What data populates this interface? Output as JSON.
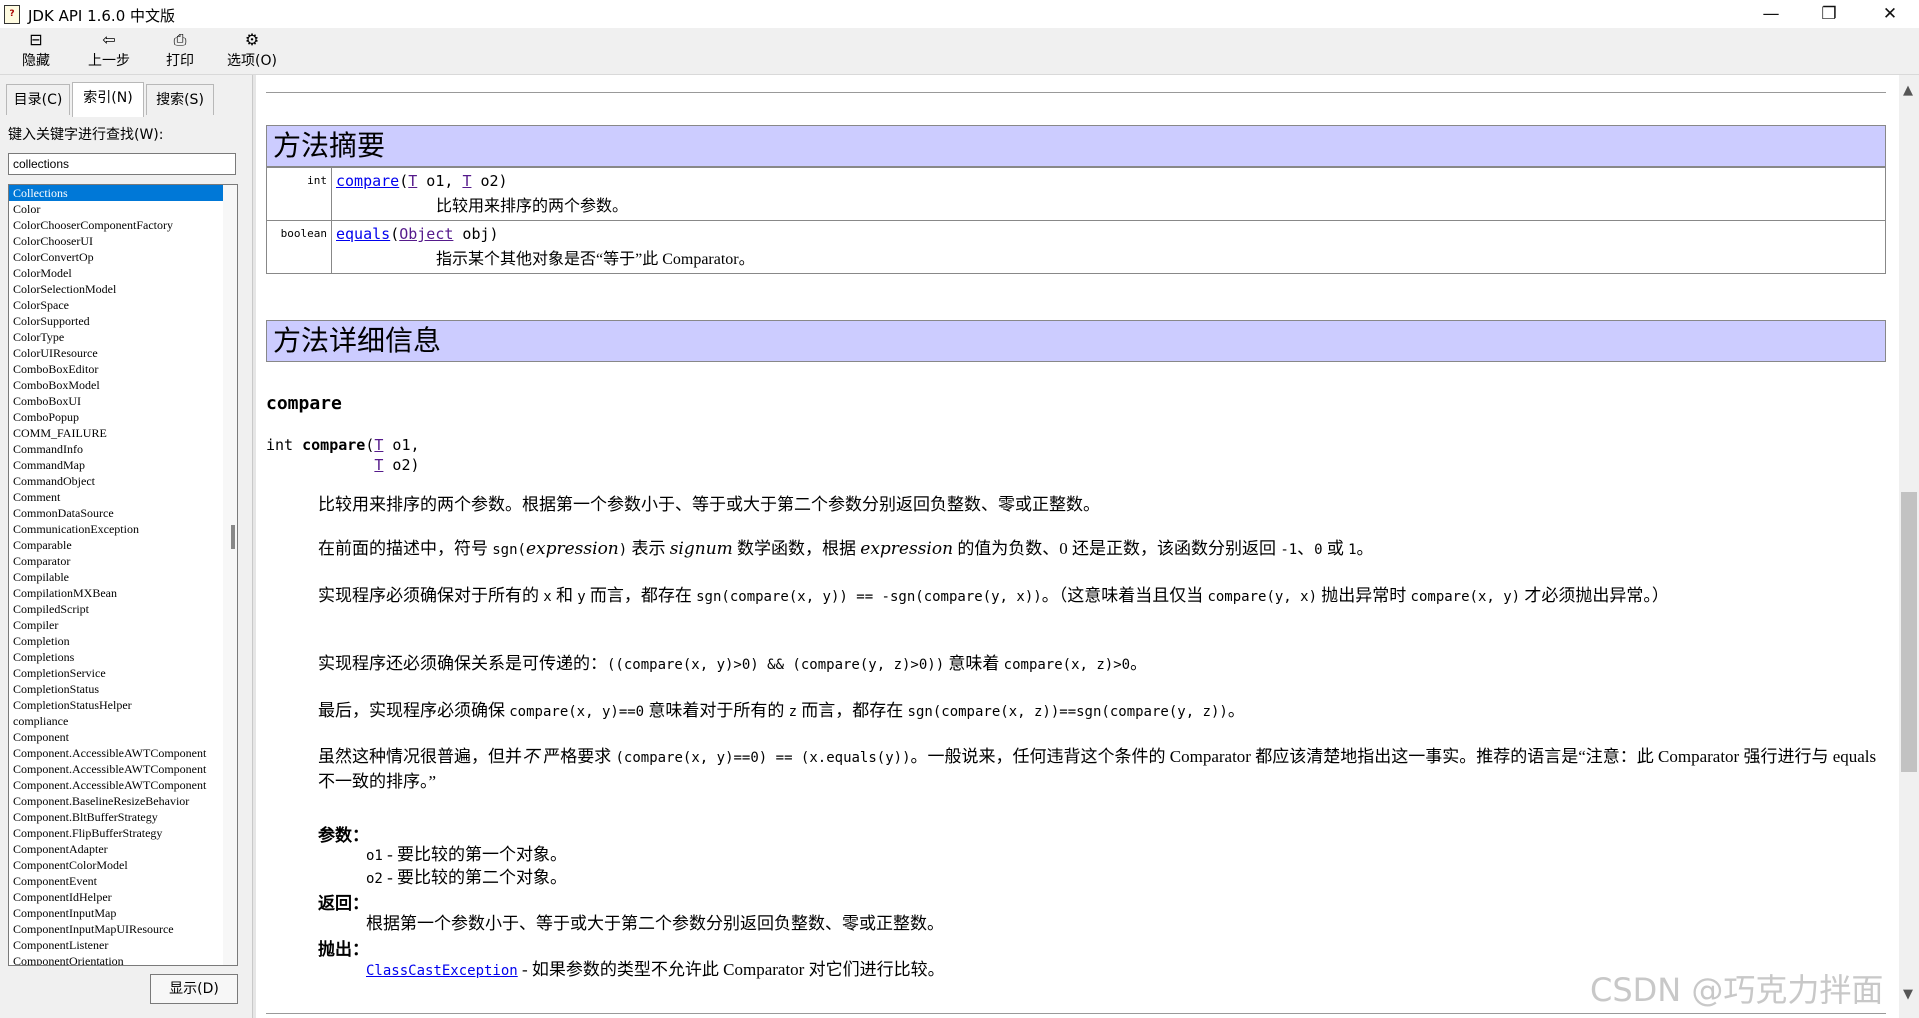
{
  "window": {
    "title": "JDK API 1.6.0 中文版",
    "minimize": "—",
    "maximize": "❐",
    "close": "✕"
  },
  "toolbar": {
    "hide": "隐藏",
    "back": "上一步",
    "print": "打印",
    "options": "选项(O)"
  },
  "sidebar": {
    "tabs": [
      "目录(C)",
      "索引(N)",
      "搜索(S)"
    ],
    "keyword_label": "键入关键字进行查找(W):",
    "keyword_value": "collections",
    "items": [
      "Collections",
      "Color",
      "ColorChooserComponentFactory",
      "ColorChooserUI",
      "ColorConvertOp",
      "ColorModel",
      "ColorSelectionModel",
      "ColorSpace",
      "ColorSupported",
      "ColorType",
      "ColorUIResource",
      "ComboBoxEditor",
      "ComboBoxModel",
      "ComboBoxUI",
      "ComboPopup",
      "COMM_FAILURE",
      "CommandInfo",
      "CommandMap",
      "CommandObject",
      "Comment",
      "CommonDataSource",
      "CommunicationException",
      "Comparable",
      "Comparator",
      "Compilable",
      "CompilationMXBean",
      "CompiledScript",
      "Compiler",
      "Completion",
      "Completions",
      "CompletionService",
      "CompletionStatus",
      "CompletionStatusHelper",
      "compliance",
      "Component",
      "Component.AccessibleAWTComponent",
      "Component.AccessibleAWTComponent",
      "Component.AccessibleAWTComponent",
      "Component.BaselineResizeBehavior",
      "Component.BltBufferStrategy",
      "Component.FlipBufferStrategy",
      "ComponentAdapter",
      "ComponentColorModel",
      "ComponentEvent",
      "ComponentIdHelper",
      "ComponentInputMap",
      "ComponentInputMapUIResource",
      "ComponentListener",
      "ComponentOrientation"
    ],
    "show_button": "显示(D)"
  },
  "content": {
    "summary_title": "方法摘要",
    "summary_rows": [
      {
        "type": "int",
        "name": "compare",
        "sig_open": "(",
        "t1": "T",
        "p1": " o1, ",
        "t2": "T",
        "p2": " o2)",
        "desc": "比较用来排序的两个参数。"
      },
      {
        "type": "boolean",
        "name": "equals",
        "sig_open": "(",
        "t1": "Object",
        "p1": " obj)",
        "desc": "指示某个其他对象是否“等于”此 Comparator。"
      }
    ],
    "detail_title": "方法详细信息",
    "method_name": "compare",
    "decl": {
      "prefix": "int ",
      "name": "compare",
      "open": "(",
      "t1": "T",
      "p1": " o1,",
      "indent": "            ",
      "t2": "T",
      "p2": " o2)"
    },
    "para1": "比较用来排序的两个参数。根据第一个参数小于、等于或大于第二个参数分别返回负整数、零或正整数。",
    "para2": {
      "a": "在前面的描述中，符号 ",
      "code1": "sgn(",
      "i1": "expression",
      "code2": ")",
      "b": " 表示 ",
      "i2": "signum",
      "c": " 数学函数，根据 ",
      "i3": "expression",
      "d": " 的值为负数、0 还是正数，该函数分别返回 ",
      "code3": "-1",
      "e": "、",
      "code4": "0",
      "f": " 或 ",
      "code5": "1",
      "g": "。"
    },
    "para3": {
      "a": "实现程序必须确保对于所有的 ",
      "code1": "x",
      "b": " 和 ",
      "code2": "y",
      "c": " 而言，都存在 ",
      "code3": "sgn(compare(x, y)) == -sgn(compare(y, x))",
      "d": "。（这意味着当且仅当 ",
      "code4": "compare(y, x)",
      "e": " 抛出异常时 ",
      "code5": "compare(x, y)",
      "f": " 才必须抛出异常。）"
    },
    "para4": {
      "a": "实现程序还必须确保关系是可传递的：",
      "code1": "((compare(x, y)>0) && (compare(y, z)>0))",
      "b": " 意味着 ",
      "code2": "compare(x, z)>0",
      "c": "。"
    },
    "para5": {
      "a": "最后，实现程序必须确保 ",
      "code1": "compare(x, y)==0",
      "b": " 意味着对于所有的 ",
      "code2": "z",
      "c": " 而言，都存在 ",
      "code3": "sgn(compare(x, z))==sgn(compare(y, z))",
      "d": "。"
    },
    "para6": {
      "a": "虽然这种情况很普遍，但并",
      "i1": "不",
      "b": " 严格要求 ",
      "code1": "(compare(x, y)==0) == (x.equals(y))",
      "c": "。一般说来，任何违背这个条件的 Comparator 都应该清楚地指出这一事实。推荐的语言是“注意：此 Comparator 强行进行与 equals 不一致的排序。”"
    },
    "params_label": "参数：",
    "param1": {
      "code": "o1",
      "text": " - 要比较的第一个对象。"
    },
    "param2": {
      "code": "o2",
      "text": " - 要比较的第二个对象。"
    },
    "returns_label": "返回：",
    "returns_text": "根据第一个参数小于、等于或大于第二个参数分别返回负整数、零或正整数。",
    "throws_label": "抛出：",
    "throws_link": "ClassCastException",
    "throws_text": " - 如果参数的类型不允许此 Comparator 对它们进行比较。"
  },
  "watermark": "CSDN @巧克力拌面"
}
